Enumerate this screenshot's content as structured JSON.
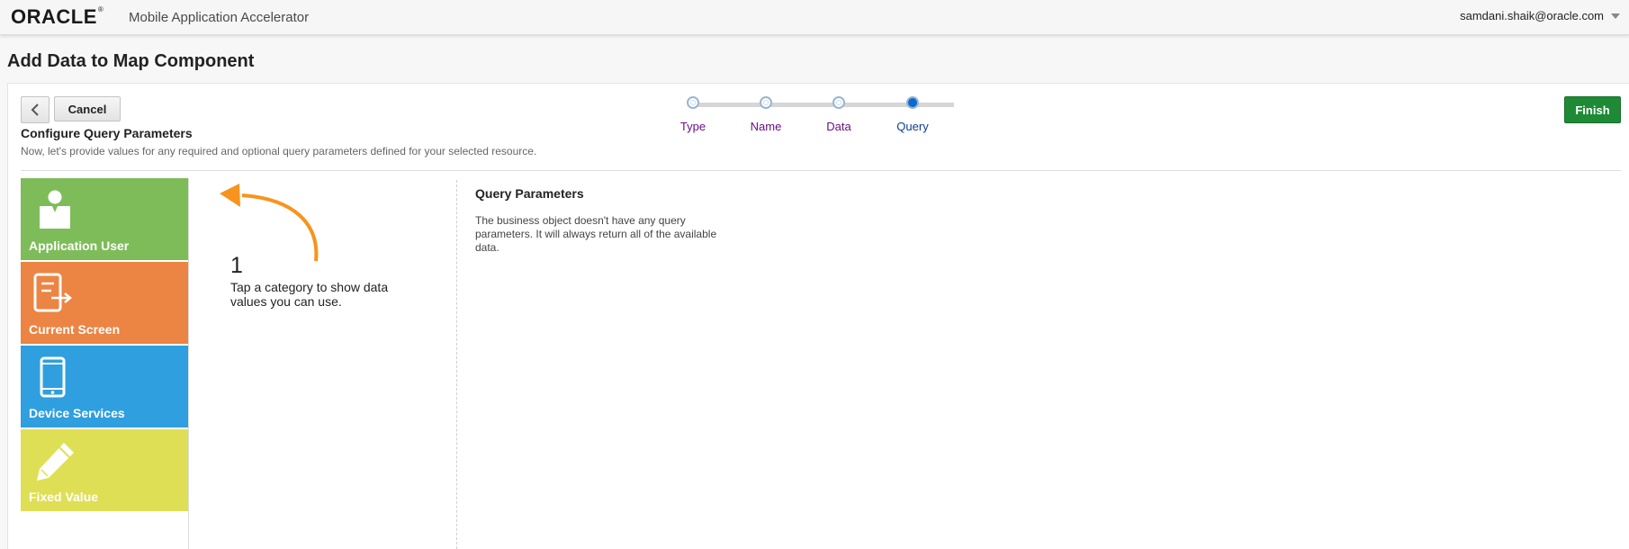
{
  "header": {
    "logo": "ORACLE",
    "app_name": "Mobile Application Accelerator",
    "user": "samdani.shaik@oracle.com"
  },
  "page": {
    "title": "Add Data to Map Component"
  },
  "toolbar": {
    "cancel_label": "Cancel",
    "finish_label": "Finish"
  },
  "train": {
    "steps": [
      {
        "label": "Type",
        "current": false
      },
      {
        "label": "Name",
        "current": false
      },
      {
        "label": "Data",
        "current": false
      },
      {
        "label": "Query",
        "current": true
      }
    ]
  },
  "section": {
    "title": "Configure Query Parameters",
    "description": "Now, let's provide values for any required and optional query parameters defined for your selected resource."
  },
  "categories": [
    {
      "label": "Application User",
      "color": "#7ebc59",
      "icon": "user-icon"
    },
    {
      "label": "Current Screen",
      "color": "#ec8443",
      "icon": "screen-icon"
    },
    {
      "label": "Device Services",
      "color": "#2f9fdf",
      "icon": "phone-icon"
    },
    {
      "label": "Fixed Value",
      "color": "#dfdf56",
      "icon": "pencil-icon"
    }
  ],
  "hint": {
    "number": "1",
    "text": "Tap a category to show data values you can use.",
    "arrow_color": "#f7941d"
  },
  "query_parameters": {
    "title": "Query Parameters",
    "message": "The business object doesn't have any query parameters. It will always return all of the available data."
  },
  "colors": {
    "finish": "#1e8a36",
    "train_current": "#0a6bd1",
    "train_label": "#6a0f87"
  }
}
